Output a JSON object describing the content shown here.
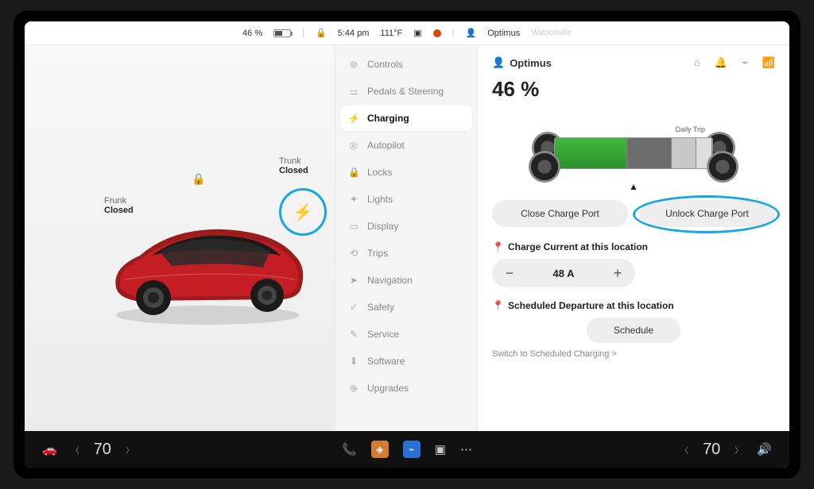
{
  "topbar": {
    "battery_pct": "46 %",
    "time": "5:44 pm",
    "temp": "111°F",
    "profile": "Optimus",
    "location_hint": "Watsonville"
  },
  "carview": {
    "frunk_label": "Frunk",
    "frunk_state": "Closed",
    "trunk_label": "Trunk",
    "trunk_state": "Closed"
  },
  "menu": {
    "items": [
      {
        "icon": "⊜",
        "label": "Controls"
      },
      {
        "icon": "⚍",
        "label": "Pedals & Steering"
      },
      {
        "icon": "⚡",
        "label": "Charging"
      },
      {
        "icon": "◎",
        "label": "Autopilot"
      },
      {
        "icon": "🔒",
        "label": "Locks"
      },
      {
        "icon": "✦",
        "label": "Lights"
      },
      {
        "icon": "▭",
        "label": "Display"
      },
      {
        "icon": "⟲",
        "label": "Trips"
      },
      {
        "icon": "➤",
        "label": "Navigation"
      },
      {
        "icon": "✓",
        "label": "Safety"
      },
      {
        "icon": "✎",
        "label": "Service"
      },
      {
        "icon": "⬇",
        "label": "Software"
      },
      {
        "icon": "⊕",
        "label": "Upgrades"
      }
    ],
    "active_index": 2
  },
  "content": {
    "profile": "Optimus",
    "battery_pct": "46 %",
    "limit_labels": "Daily   Trip",
    "close_port": "Close Charge Port",
    "unlock_port": "Unlock Charge Port",
    "current_label": "Charge Current at this location",
    "current_value": "48 A",
    "scheduled_label": "Scheduled Departure at this location",
    "schedule_btn": "Schedule",
    "switch_link": "Switch to Scheduled Charging >"
  },
  "bottombar": {
    "left_temp": "70",
    "right_temp": "70"
  },
  "colors": {
    "accent": "#17a7df",
    "green": "#3fb93f"
  }
}
